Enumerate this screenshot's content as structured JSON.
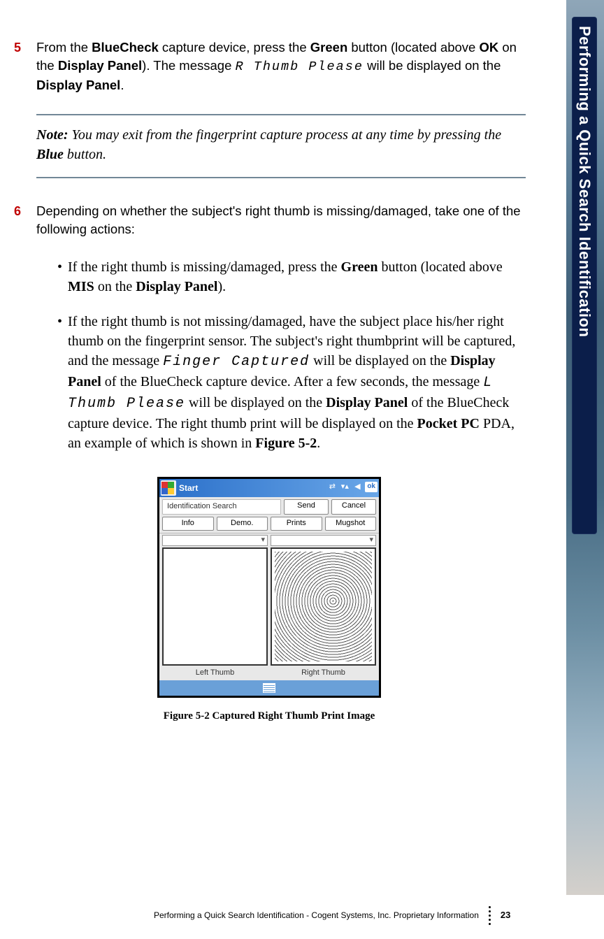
{
  "sidebar": {
    "tab_title": "Performing a Quick Search Identification"
  },
  "steps": {
    "s5": {
      "num": "5",
      "parts": [
        "From the ",
        {
          "b": "BlueCheck"
        },
        " capture device, press the ",
        {
          "b": "Green"
        },
        " button (located above ",
        {
          "b": "OK"
        },
        " on the ",
        {
          "b": "Display Panel"
        },
        "). The message ",
        {
          "m": "R Thumb Please"
        },
        " will be displayed on the ",
        {
          "b": "Display Panel"
        },
        "."
      ]
    },
    "note": {
      "prefix": "Note:",
      "parts": [
        " You may exit from the fingerprint capture process at any time by pressing the ",
        {
          "b": "Blue"
        },
        " button."
      ]
    },
    "s6": {
      "num": "6",
      "text": "Depending on whether the subject's right thumb is missing/damaged, take one of the following actions:"
    },
    "b1": {
      "parts": [
        "If the right thumb is missing/damaged, press the ",
        {
          "b": "Green"
        },
        " button (located above ",
        {
          "b": "MIS"
        },
        " on the ",
        {
          "b": "Display Panel"
        },
        ")."
      ]
    },
    "b2": {
      "parts": [
        "If the right thumb is not missing/damaged, have the subject place his/her right thumb on the fingerprint sensor. The subject's right thumbprint will be captured, and the message ",
        {
          "m": "Finger Captured"
        },
        " will be displayed on the ",
        {
          "b": "Display Panel"
        },
        " of the BlueCheck capture device. After a few seconds, the message ",
        {
          "m": "L Thumb Please"
        },
        " will be displayed on the ",
        {
          "b": "Display Panel"
        },
        " of the BlueCheck capture device. The right thumb print will be displayed on the ",
        {
          "b": "Pocket PC"
        },
        " PDA, an example of which is shown in ",
        {
          "b": "Figure 5-2"
        },
        "."
      ]
    }
  },
  "ppc": {
    "start": "Start",
    "ok": "ok",
    "row1_label": "Identification Search",
    "row1_btn1": "Send",
    "row1_btn2": "Cancel",
    "row2_btn1": "Info",
    "row2_btn2": "Demo.",
    "row2_btn3": "Prints",
    "row2_btn4": "Mugshot",
    "left_caption": "Left Thumb",
    "right_caption": "Right Thumb"
  },
  "figure_caption": "Figure 5-2 Captured Right Thumb Print Image",
  "footer": {
    "text": "Performing a Quick Search Identification  - Cogent Systems, Inc. Proprietary Information",
    "page": "23"
  }
}
